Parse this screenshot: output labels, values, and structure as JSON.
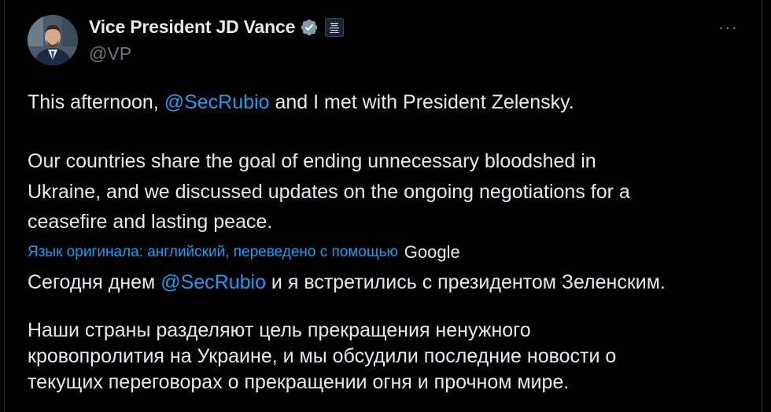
{
  "author": {
    "name": "Vice President JD Vance",
    "handle": "@VP",
    "verified_color": "#829aab",
    "avatar_icon": "portrait-avatar",
    "affiliation_icon": "white-house-seal-icon"
  },
  "more_label": "···",
  "original": {
    "line1_prefix": "This afternoon, ",
    "line1_mention": "@SecRubio",
    "line1_suffix": " and I met with President Zelensky.",
    "para2_line1": "Our countries share the goal of ending unnecessary bloodshed in",
    "para2_line2": "Ukraine, and we discussed updates on the ongoing negotiations for a",
    "para2_line3": "ceasefire and lasting peace."
  },
  "translation_note": "Язык оригинала: английский, переведено с помощью",
  "translation_provider": "Google",
  "translated": {
    "line1_prefix": "Сегодня днем ",
    "line1_mention": "@SecRubio",
    "line1_suffix": " и я встретились с президентом Зеленским.",
    "para2_line1": "Наши страны разделяют цель прекращения ненужного",
    "para2_line2": "кровопролития на Украине, и мы обсудили последние новости о",
    "para2_line3": "текущих переговорах о прекращении огня и прочном мире."
  },
  "colors": {
    "link": "#1d9bf0",
    "muted": "#71767b",
    "text": "#e7e9ea",
    "background": "#000000"
  }
}
